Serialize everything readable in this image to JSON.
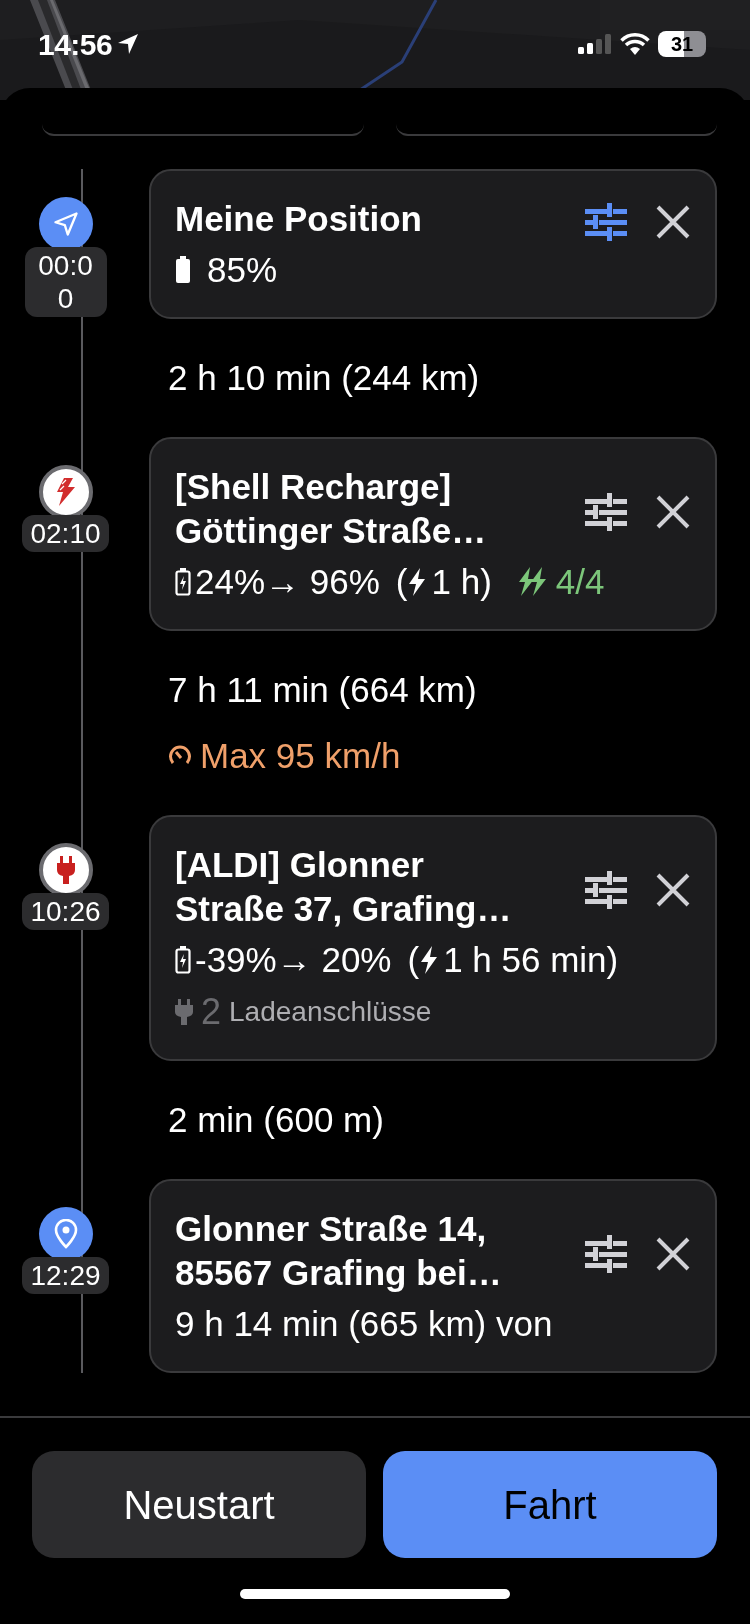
{
  "status_bar": {
    "time": "14:56",
    "battery": "31"
  },
  "timeline": [
    {
      "kind": "origin",
      "time": "00:00",
      "time_wrapped": true,
      "title": "Meine Position",
      "filter_active": true,
      "details": [
        {
          "kind": "battery",
          "value": "85%"
        }
      ]
    },
    {
      "kind": "leg",
      "text": "2 h 10 min (244 km)"
    },
    {
      "kind": "brand_charger",
      "time": "02:10",
      "time_wrapped": false,
      "title": "[Shell Recharge] Göttinger Straße…",
      "filter_active": false,
      "details": [
        {
          "kind": "charge",
          "range": "24%→ 96%",
          "paren": "(",
          "duration": "1 h)",
          "chargers": "4/4"
        }
      ]
    },
    {
      "kind": "leg",
      "text": "7 h 11 min (664 km)",
      "speed_limit": "Max 95 km/h"
    },
    {
      "kind": "charger",
      "time": "10:26",
      "time_wrapped": false,
      "title": "[ALDI] Glonner Straße 37, Grafing…",
      "filter_active": false,
      "details": [
        {
          "kind": "charge",
          "range": "-39%→ 20%",
          "paren": "(",
          "duration": "1 h 56 min)"
        },
        {
          "kind": "ports",
          "count": "2",
          "label": "Ladeanschlüsse"
        }
      ]
    },
    {
      "kind": "leg",
      "text": "2 min (600 m)"
    },
    {
      "kind": "destination",
      "time": "12:29",
      "time_wrapped": false,
      "title": "Glonner Straße 14, 85567 Grafing bei…",
      "filter_active": false,
      "details": [
        {
          "kind": "text",
          "value": "9 h 14 min (665 km) von"
        }
      ]
    }
  ],
  "buttons": [
    {
      "label": "Neustart",
      "kind": "secondary"
    },
    {
      "label": "Fahrt",
      "kind": "primary"
    }
  ]
}
